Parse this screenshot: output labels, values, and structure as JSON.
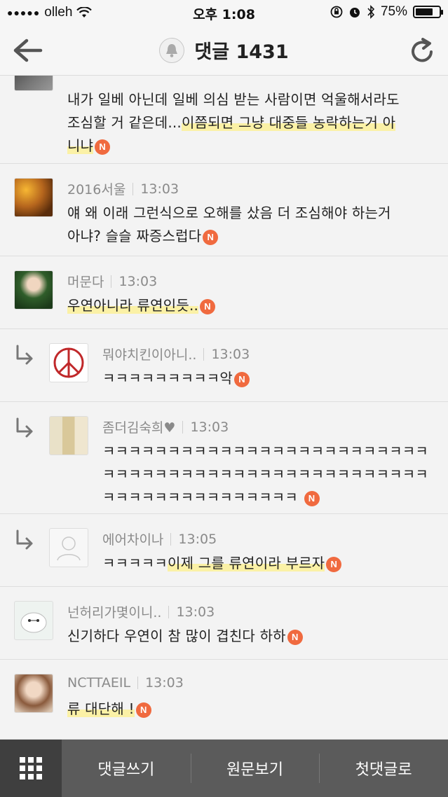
{
  "status_bar": {
    "carrier": "olleh",
    "time": "오후 1:08",
    "battery": "75%",
    "battery_level": 0.75
  },
  "header": {
    "title": "댓글 1431"
  },
  "comments": [
    {
      "id": "c0",
      "author": "",
      "time": "",
      "lines": [
        [
          {
            "t": "내가 일베 아닌데 일베 의심 받는 사람이면 억울해서라도"
          }
        ],
        [
          {
            "t": "조심할 거 같은데..."
          },
          {
            "t": "이쯤되면 그냥 대중들 농락하는거 아",
            "hl": true
          }
        ],
        [
          {
            "t": "니냐",
            "hl": true
          },
          {
            "badge": "N"
          }
        ]
      ]
    },
    {
      "id": "c1",
      "author": "2016서울",
      "time": "13:03",
      "lines": [
        [
          {
            "t": "얘 왜 이래 그런식으로 오해를 샀음 더 조심해야 하는거"
          }
        ],
        [
          {
            "t": "아냐? 슬슬 짜증스럽다"
          },
          {
            "badge": "N"
          }
        ]
      ]
    },
    {
      "id": "c2",
      "author": "머문다",
      "time": "13:03",
      "lines": [
        [
          {
            "t": "우연아니라 류연인듯..",
            "hl": true
          },
          {
            "badge": "N"
          }
        ]
      ]
    },
    {
      "id": "c3",
      "author": "뭐야치킨이아니..",
      "time": "13:03",
      "reply": true,
      "lines": [
        [
          {
            "t": "ㅋㅋㅋㅋㅋㅋㅋㅋㅋ악"
          },
          {
            "badge": "N"
          }
        ]
      ]
    },
    {
      "id": "c4",
      "author": "좀더김숙희♥",
      "time": "13:03",
      "reply": true,
      "lines": [
        [
          {
            "t": "ㅋㅋㅋㅋㅋㅋㅋㅋㅋㅋㅋㅋㅋㅋㅋㅋㅋㅋㅋㅋㅋㅋㅋㅋㅋ"
          }
        ],
        [
          {
            "t": "ㅋㅋㅋㅋㅋㅋㅋㅋㅋㅋㅋㅋㅋㅋㅋㅋㅋㅋㅋㅋㅋㅋㅋㅋㅋ"
          }
        ],
        [
          {
            "t": "ㅋㅋㅋㅋㅋㅋㅋㅋㅋㅋㅋㅋㅋㅋㅋ "
          },
          {
            "badge": "N"
          }
        ]
      ]
    },
    {
      "id": "c5",
      "author": "에어차이나",
      "time": "13:05",
      "reply": true,
      "lines": [
        [
          {
            "t": "ㅋㅋㅋㅋㅋ"
          },
          {
            "t": "이제 그를 류연이라 부르자",
            "hl": true
          },
          {
            "badge": "N"
          }
        ]
      ]
    },
    {
      "id": "c6",
      "author": "넌허리가몇이니..",
      "time": "13:03",
      "lines": [
        [
          {
            "t": "신기하다 우연이 참 많이 겹친다 하하"
          },
          {
            "badge": "N"
          }
        ]
      ]
    },
    {
      "id": "c7",
      "author": "NCTTAEIL",
      "time": "13:03",
      "lines": [
        [
          {
            "t": "류 대단해 !",
            "hl": true
          },
          {
            "badge": "N"
          }
        ]
      ]
    }
  ],
  "bottom_bar": {
    "write": "댓글쓰기",
    "original": "원문보기",
    "first": "첫댓글로"
  },
  "colors": {
    "badge": "#f06a3f",
    "highlight": "#fbf1a6",
    "bottom_bar": "#5b5b5b"
  }
}
